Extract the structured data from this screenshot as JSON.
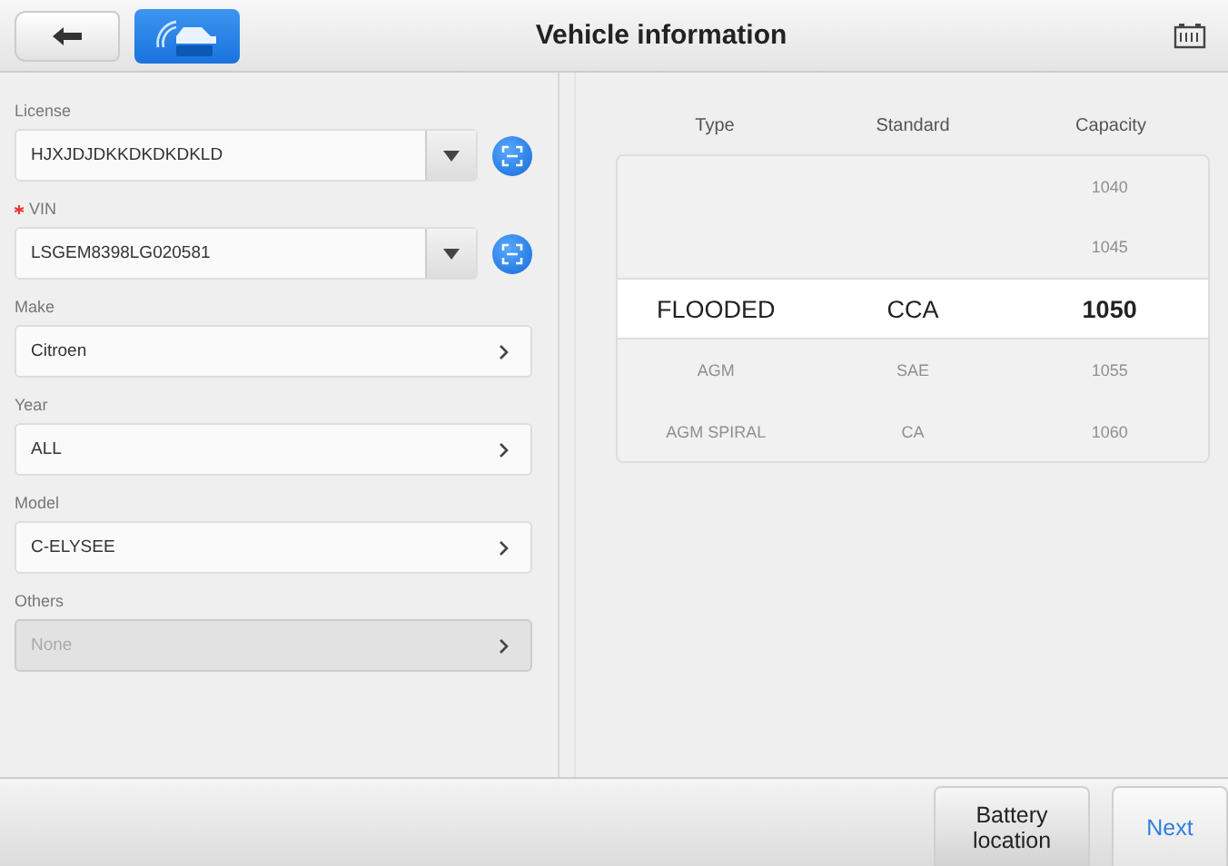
{
  "header": {
    "title": "Vehicle information"
  },
  "fields": [
    {
      "label": "License",
      "value": "HJXJDJDKKDKDKDKLD",
      "kind": "dropdown",
      "required": false,
      "disabled": false
    },
    {
      "label": "VIN",
      "value": "LSGEM8398LG020581",
      "kind": "dropdown",
      "required": true,
      "disabled": false
    },
    {
      "label": "Make",
      "value": "Citroen",
      "kind": "select",
      "required": false,
      "disabled": false
    },
    {
      "label": "Year",
      "value": "ALL",
      "kind": "select",
      "required": false,
      "disabled": false
    },
    {
      "label": "Model",
      "value": "C-ELYSEE",
      "kind": "select",
      "required": false,
      "disabled": false
    },
    {
      "label": "Others",
      "value": "None",
      "kind": "select",
      "required": false,
      "disabled": true
    }
  ],
  "picker": {
    "columns": [
      "Type",
      "Standard",
      "Capacity"
    ],
    "rows": [
      {
        "capacity": "1040",
        "selected": false
      },
      {
        "capacity": "1045",
        "selected": false
      },
      {
        "type": "FLOODED",
        "standard": "CCA",
        "capacity": "1050",
        "selected": true
      },
      {
        "type": "AGM",
        "standard": "SAE",
        "capacity": "1055",
        "selected": false
      },
      {
        "type": "AGM SPIRAL",
        "standard": "CA",
        "capacity": "1060",
        "selected": false
      }
    ]
  },
  "footer": {
    "buttons": [
      {
        "label": "Battery location",
        "kind": "secondary"
      },
      {
        "label": "Next",
        "kind": "primary"
      }
    ]
  }
}
